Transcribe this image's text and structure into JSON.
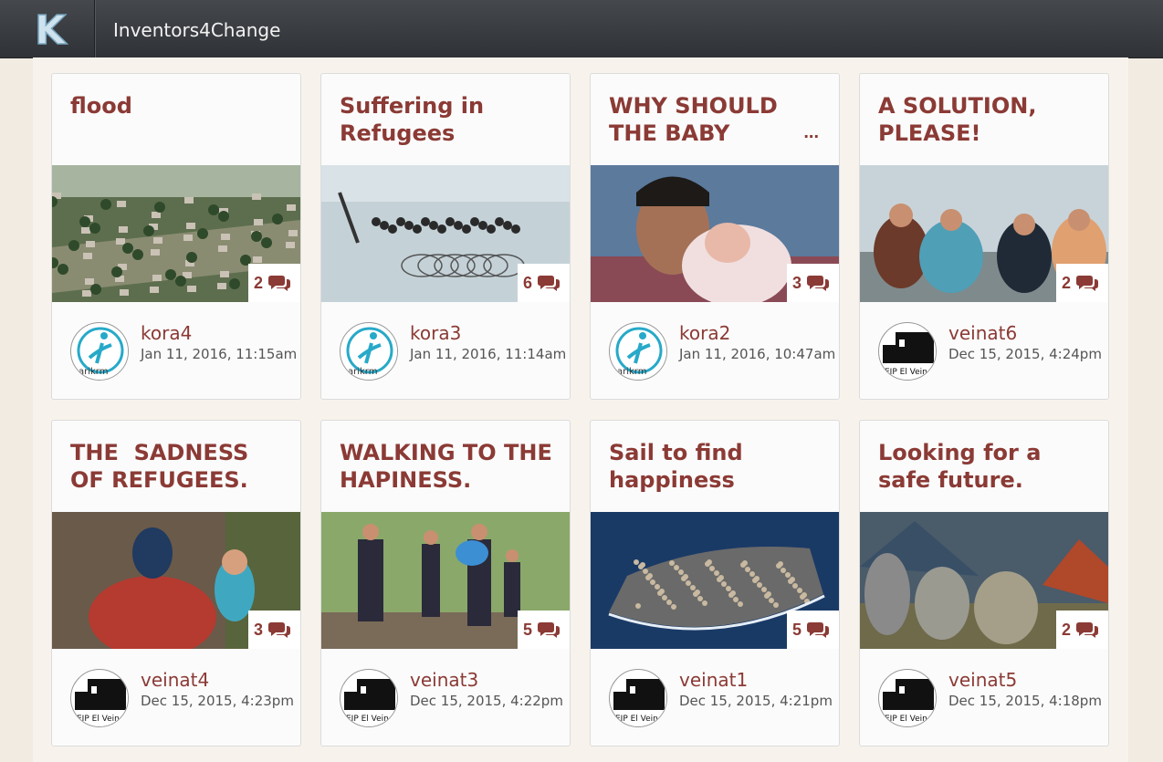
{
  "app": {
    "title": "Inventors4Change",
    "logo_letter": "K"
  },
  "colors": {
    "accent": "#8b3a35",
    "topbar": "#3a3d42",
    "background": "#f1ebe1"
  },
  "cards": [
    {
      "title": "flood",
      "comments": "2",
      "author": "kora4",
      "date": "Jan 11, 2016, 11:15am",
      "avatar": "parikrma-logo",
      "avatar_text": "arikrm",
      "more": ""
    },
    {
      "title": "Suffering in Refugees",
      "comments": "6",
      "author": "kora3",
      "date": "Jan 11, 2016, 11:14am",
      "avatar": "parikrma-logo",
      "avatar_text": "arikrm",
      "more": ""
    },
    {
      "title": "WHY SHOULD THE BABY SUFFER ?",
      "comments": "3",
      "author": "kora2",
      "date": "Jan 11, 2016, 10:47am",
      "avatar": "parikrma-logo",
      "avatar_text": "arikrm",
      "more": "..."
    },
    {
      "title": "A SOLUTION, PLEASE!",
      "comments": "2",
      "author": "veinat6",
      "date": "Dec 15, 2015, 4:24pm",
      "avatar": "eip-el-vein-logo",
      "avatar_text": "EIP El Vein",
      "more": ""
    },
    {
      "title": "THE  SADNESS  OF REFUGEES.",
      "comments": "3",
      "author": "veinat4",
      "date": "Dec 15, 2015, 4:23pm",
      "avatar": "eip-el-vein-logo",
      "avatar_text": "EIP El Vein",
      "more": ""
    },
    {
      "title": "WALKING TO THE HAPINESS.",
      "comments": "5",
      "author": "veinat3",
      "date": "Dec 15, 2015, 4:22pm",
      "avatar": "eip-el-vein-logo",
      "avatar_text": "EIP El Vein",
      "more": ""
    },
    {
      "title": "Sail to find happiness",
      "comments": "5",
      "author": "veinat1",
      "date": "Dec 15, 2015, 4:21pm",
      "avatar": "eip-el-vein-logo",
      "avatar_text": "EIP El Vein",
      "more": ""
    },
    {
      "title": "Looking for a safe future.",
      "comments": "2",
      "author": "veinat5",
      "date": "Dec 15, 2015, 4:18pm",
      "avatar": "eip-el-vein-logo",
      "avatar_text": "EIP El Vein",
      "more": ""
    }
  ]
}
